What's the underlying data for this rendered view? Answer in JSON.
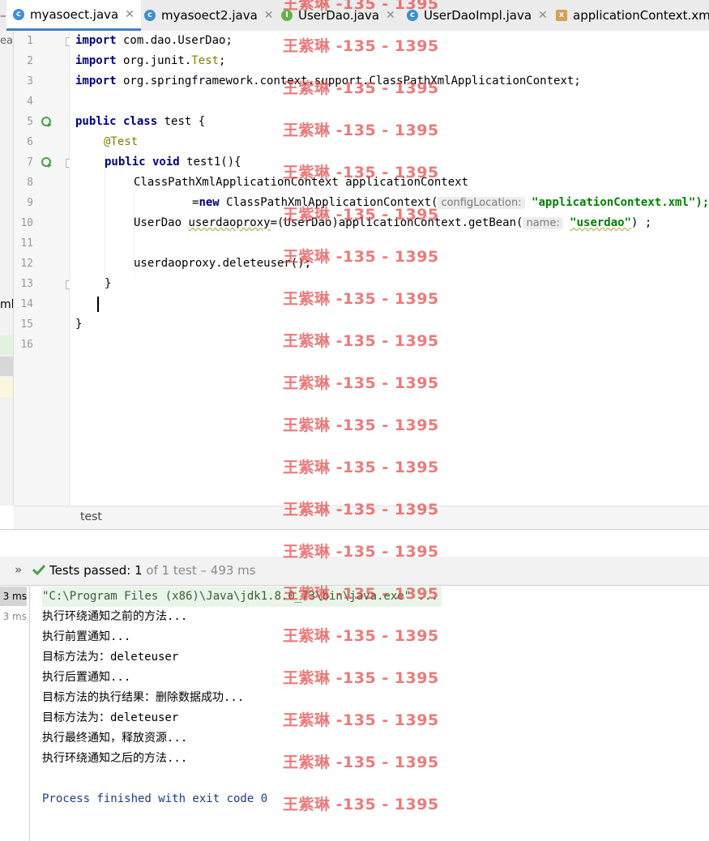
{
  "tabs": [
    {
      "label": "myasoect.java",
      "icon": "c",
      "active": true
    },
    {
      "label": "myasoect2.java",
      "icon": "c",
      "active": false
    },
    {
      "label": "UserDao.java",
      "icon": "i",
      "active": false
    },
    {
      "label": "UserDaoImpl.java",
      "icon": "c",
      "active": false
    },
    {
      "label": "applicationContext.xml",
      "icon": "xml",
      "active": false
    }
  ],
  "left_strip": {
    "top_fragment": "ea",
    "mid_fragment": "ml"
  },
  "line_numbers": [
    "1",
    "2",
    "3",
    "4",
    "5",
    "6",
    "7",
    "8",
    "9",
    "10",
    "11",
    "12",
    "13",
    "14",
    "15",
    "16"
  ],
  "code": {
    "l1_kw": "import",
    "l1_rest": " com.dao.UserDao;",
    "l2_kw": "import",
    "l2_a": " org.junit.",
    "l2_ann": "Test",
    "l2_b": ";",
    "l3_kw": "import",
    "l3_rest": " org.springframework.context.support.ClassPathXmlApplicationContext;",
    "l5_kw": "public class",
    "l5_rest": " test {",
    "l6_ann": "@Test",
    "l7_kw": "public void",
    "l7_rest": " test1(){",
    "l8": "ClassPathXmlApplicationContext applicationContext",
    "l9_a": "=",
    "l9_kw": "new",
    "l9_b": " ClassPathXmlApplicationContext(",
    "l9_hint": "configLocation:",
    "l9_str": "\"applicationContext.xml\");",
    "l10_a": "UserDao ",
    "l10_var": "userdaoproxy",
    "l10_b": "=(UserDao)applicationContext.getBean(",
    "l10_hint": "name:",
    "l10_str": "\"userdao\"",
    "l10_c": ") ;",
    "l12": "userdaoproxy.deleteuser();",
    "l13": "}",
    "l15": "}"
  },
  "breadcrumb": "test",
  "test_status": {
    "expand": "»",
    "label": "Tests passed:",
    "passed": "1",
    "of_text": "of 1 test – 493 ms"
  },
  "times": [
    "3 ms",
    "3 ms"
  ],
  "console": {
    "command": "\"C:\\Program Files (x86)\\Java\\jdk1.8.0_73\\bin\\java.exe\" ...",
    "lines": [
      "执行环绕通知之前的方法...",
      "执行前置通知...",
      "目标方法为：deleteuser",
      "执行后置通知...",
      "目标方法的执行结果：删除数据成功...",
      "目标方法为：deleteuser",
      "执行最终通知，释放资源...",
      "执行环绕通知之后的方法..."
    ],
    "exit": "Process finished with exit code 0"
  },
  "watermark": "王紫琳 -135 - 1395",
  "colors": {
    "keyword": "#000080",
    "annotation": "#808000",
    "string": "#008000",
    "pass": "#48a047",
    "watermark": "#e64646"
  }
}
